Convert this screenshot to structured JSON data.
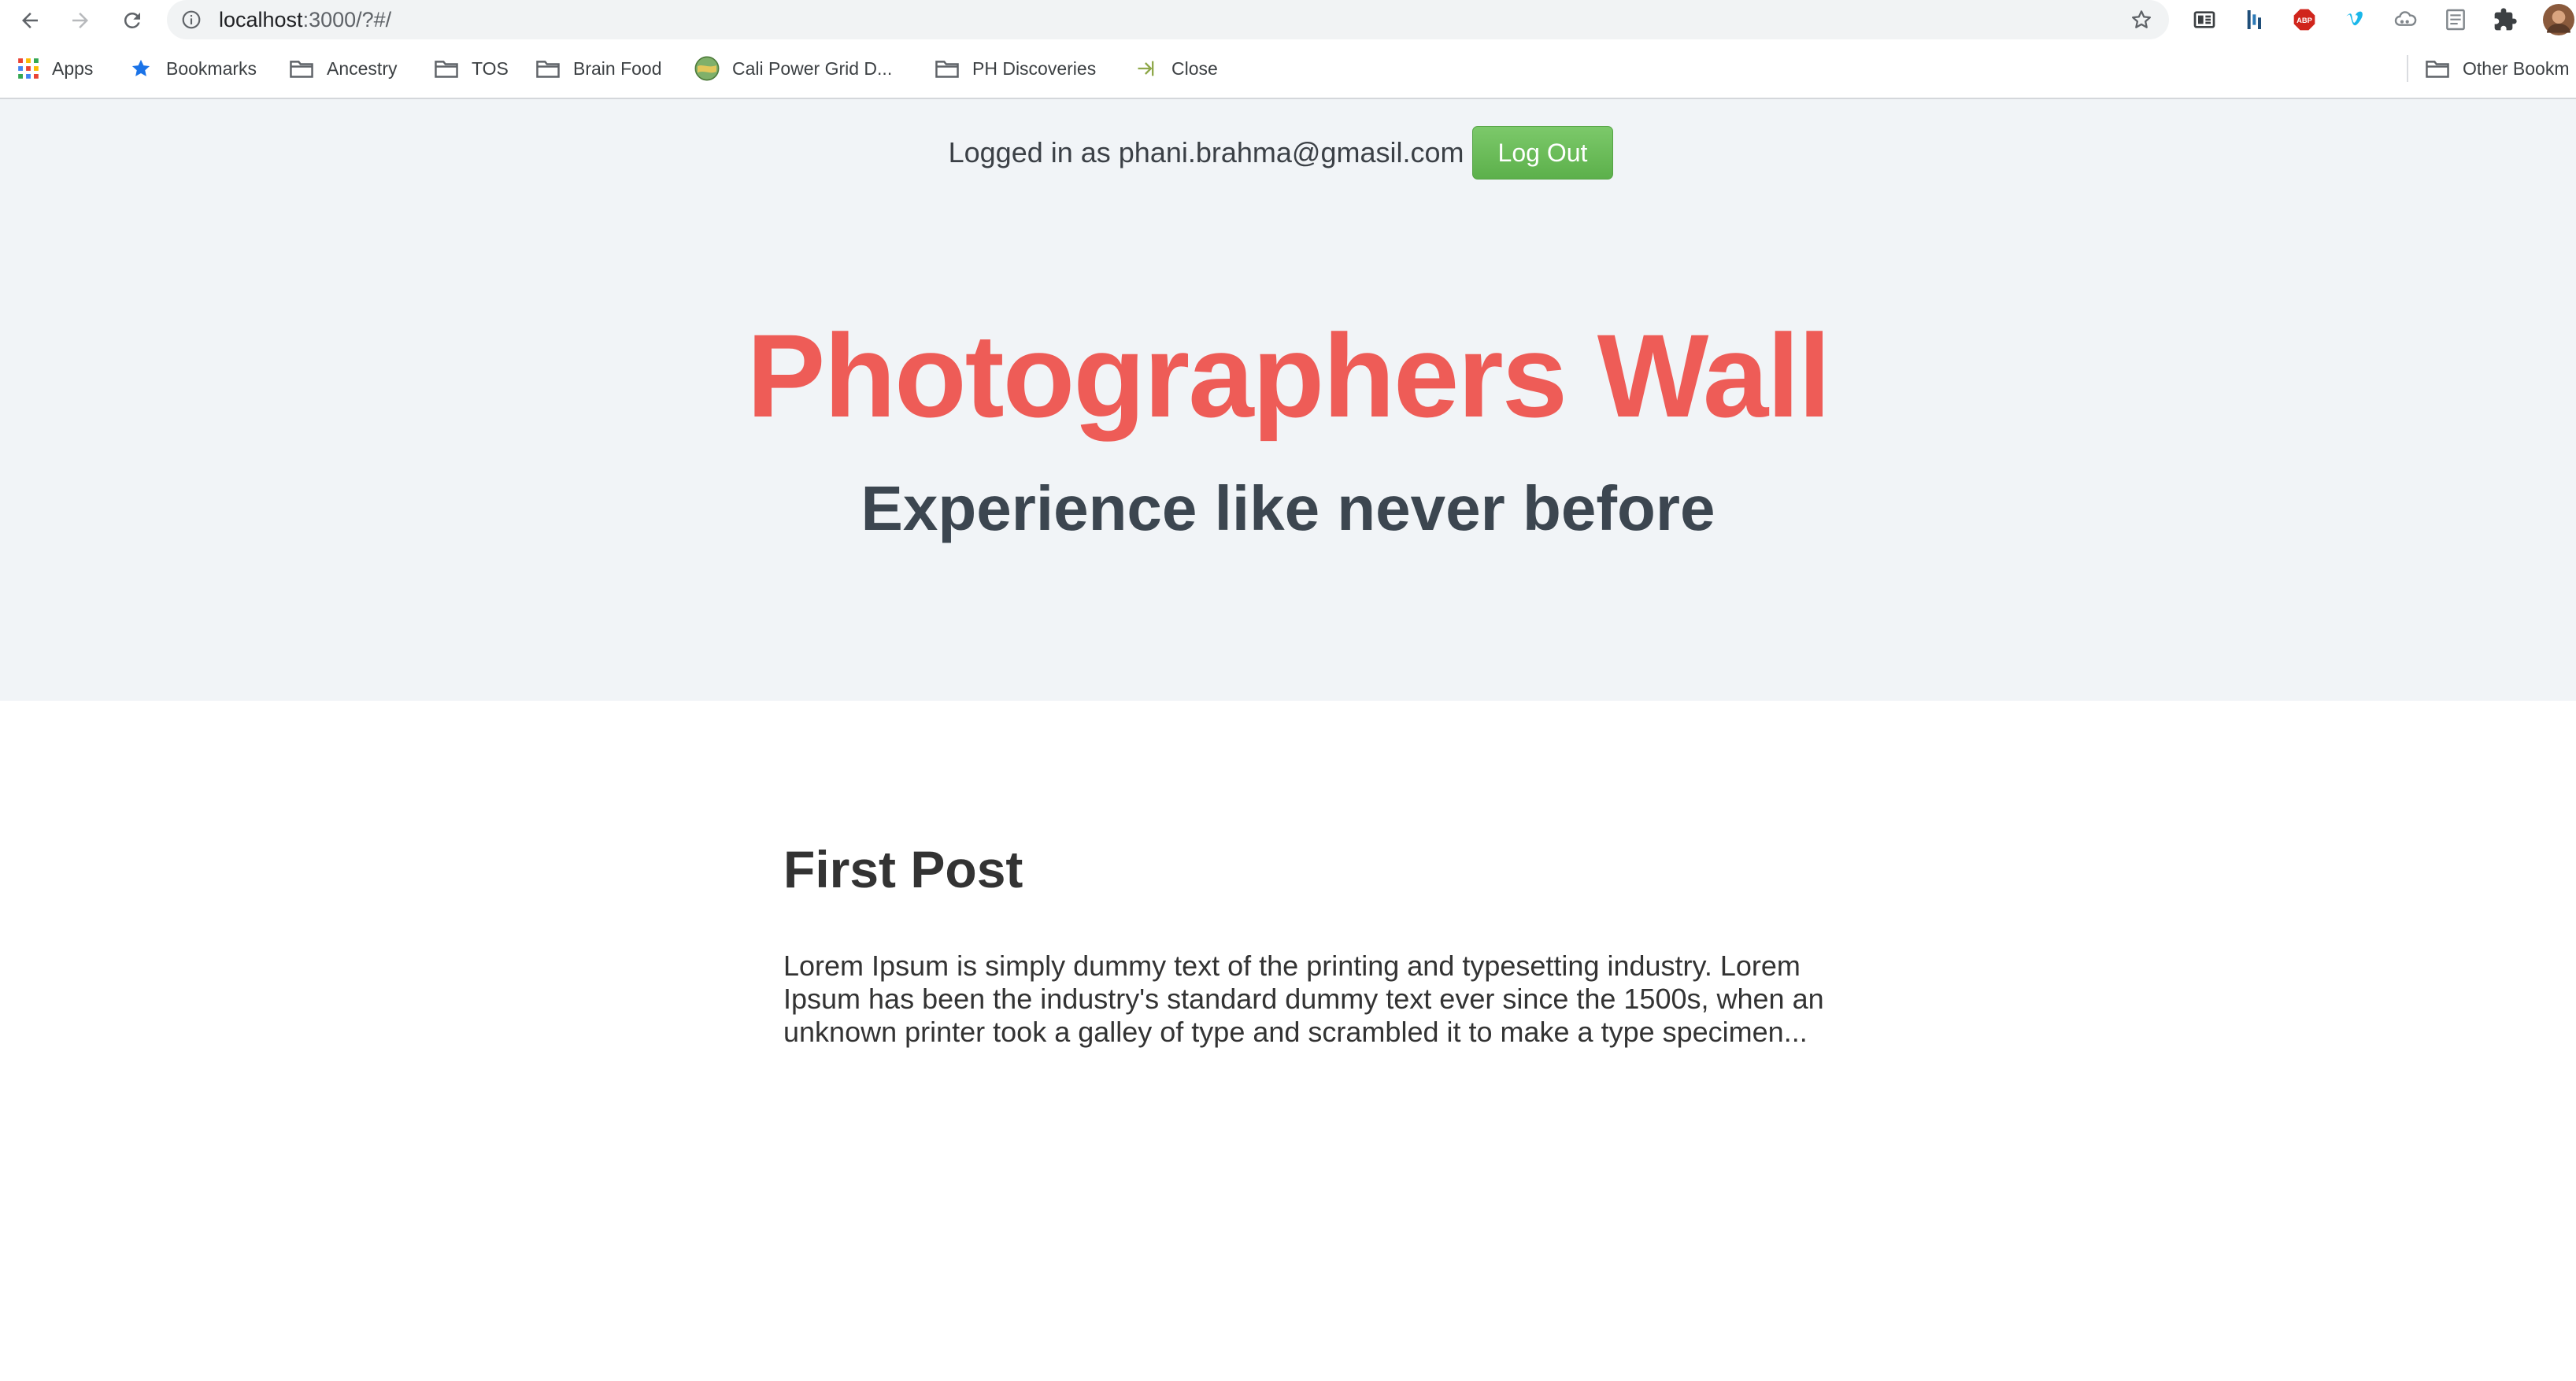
{
  "browser": {
    "url_host": "localhost",
    "url_path": ":3000/?#/",
    "icons": {
      "back": "arrow-left-icon",
      "forward": "arrow-right-icon",
      "reload": "reload-icon",
      "site_info": "info-circle-icon",
      "bookmark_star": "star-icon"
    },
    "extensions": [
      "reader-icon",
      "bar-chart-icon",
      "adblock-icon",
      "vimeo-icon",
      "cloud-icon",
      "document-icon",
      "puzzle-icon",
      "profile-avatar"
    ],
    "adblock_label": "ABP"
  },
  "bookmarks": {
    "items": [
      {
        "label": "Apps",
        "icon": "apps-grid-icon"
      },
      {
        "label": "Bookmarks",
        "icon": "star-icon"
      },
      {
        "label": "Ancestry",
        "icon": "folder-icon"
      },
      {
        "label": "TOS",
        "icon": "folder-icon"
      },
      {
        "label": "Brain Food",
        "icon": "folder-icon"
      },
      {
        "label": "Cali Power Grid D...",
        "icon": "globe-icon"
      },
      {
        "label": "PH Discoveries",
        "icon": "folder-icon"
      },
      {
        "label": "Close",
        "icon": "close-arrow-icon"
      }
    ],
    "other": {
      "label": "Other Bookm",
      "icon": "folder-icon"
    }
  },
  "header": {
    "logged_in_text": "Logged in as phani.brahma@gmasil.com",
    "logout_label": "Log Out",
    "title": "Photographers Wall",
    "subtitle": "Experience like never before"
  },
  "posts": [
    {
      "title": "First Post",
      "body": "Lorem Ipsum is simply dummy text of the printing and typesetting industry. Lorem Ipsum has been the industry's standard dummy text ever since the 1500s, when an unknown printer took a galley of type and scrambled it to make a type specimen..."
    }
  ],
  "colors": {
    "title": "#ee5c57",
    "hero_bg": "#f1f4f7",
    "logout_bg": "#5cb04b",
    "text": "#333333"
  }
}
